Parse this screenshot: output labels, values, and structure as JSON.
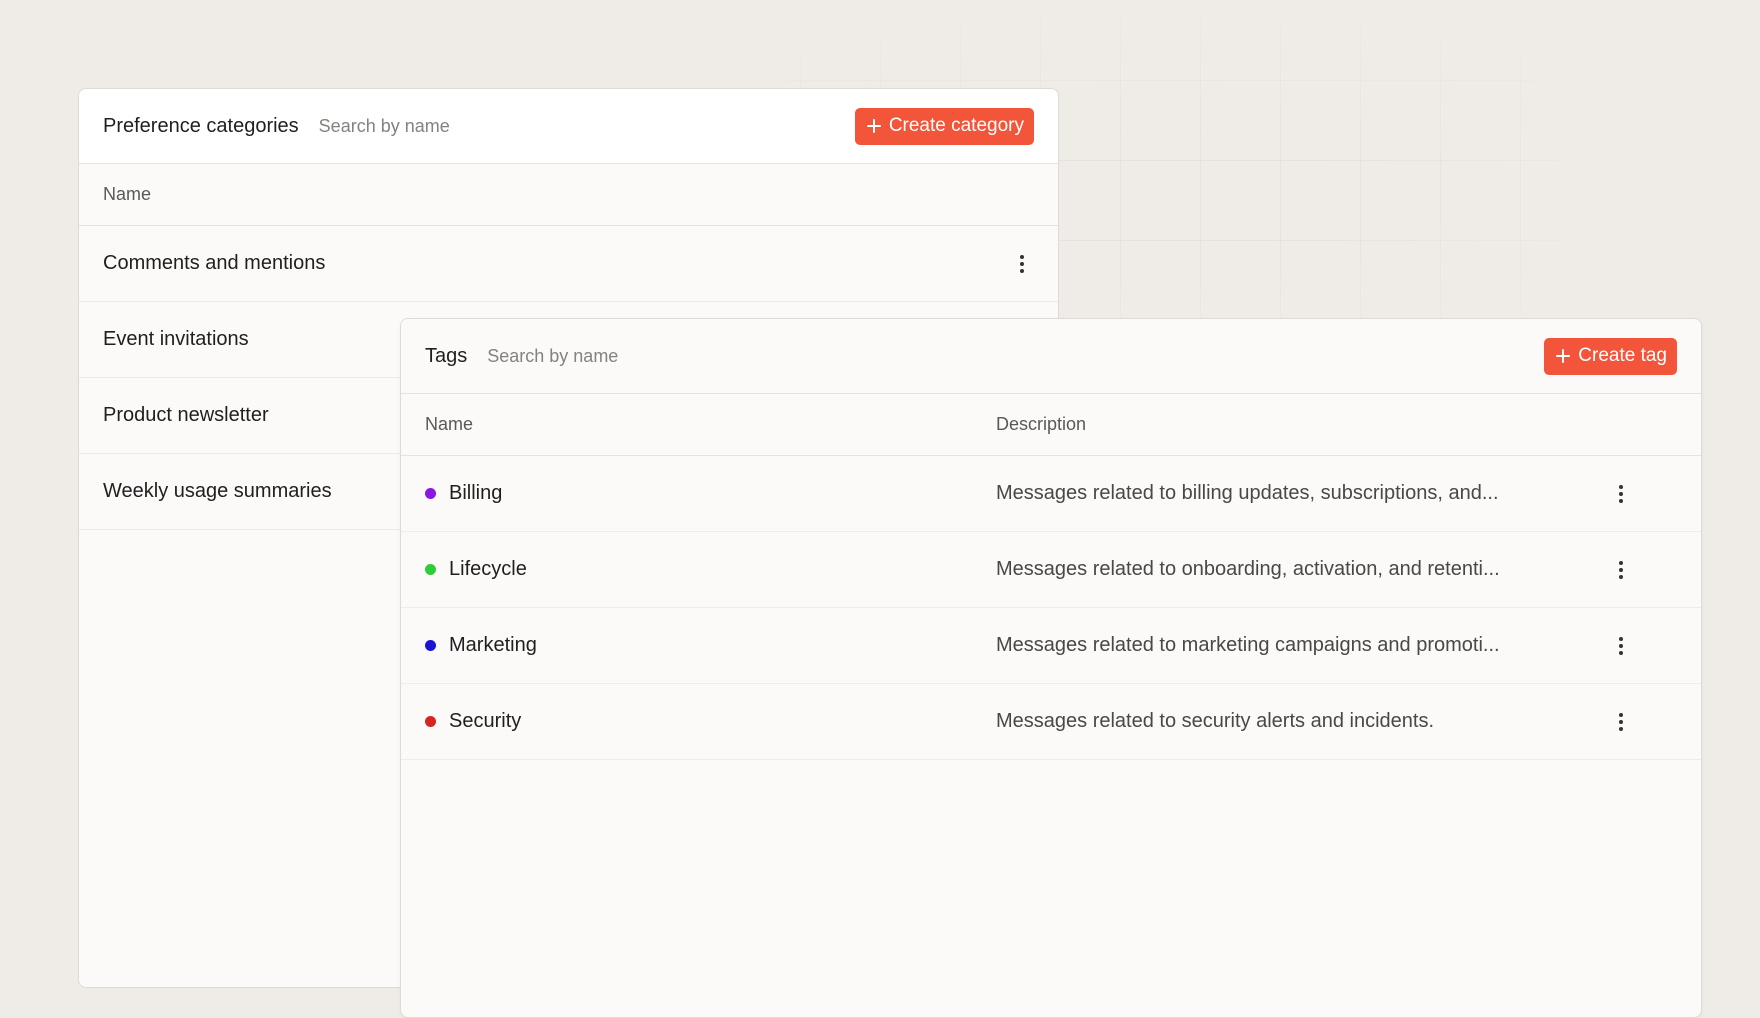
{
  "categories_panel": {
    "title": "Preference categories",
    "search_placeholder": "Search by name",
    "create_button": "Create category",
    "column_name": "Name",
    "rows": [
      {
        "name": "Comments and mentions"
      },
      {
        "name": "Event invitations"
      },
      {
        "name": "Product newsletter"
      },
      {
        "name": "Weekly usage summaries"
      }
    ]
  },
  "tags_panel": {
    "title": "Tags",
    "search_placeholder": "Search by name",
    "create_button": "Create tag",
    "column_name": "Name",
    "column_description": "Description",
    "rows": [
      {
        "name": "Billing",
        "color": "#8b16e0",
        "description": "Messages related to billing updates, subscriptions, and..."
      },
      {
        "name": "Lifecycle",
        "color": "#2fcc3a",
        "description": "Messages related to onboarding, activation, and retenti..."
      },
      {
        "name": "Marketing",
        "color": "#1a14d6",
        "description": "Messages related to marketing campaigns and promoti..."
      },
      {
        "name": "Security",
        "color": "#d8241e",
        "description": "Messages related to security alerts and incidents."
      }
    ]
  },
  "icons": {
    "create": "plus-icon",
    "row_menu": "kebab-menu-icon"
  },
  "colors": {
    "accent": "#f2553a",
    "background": "#efece7"
  }
}
